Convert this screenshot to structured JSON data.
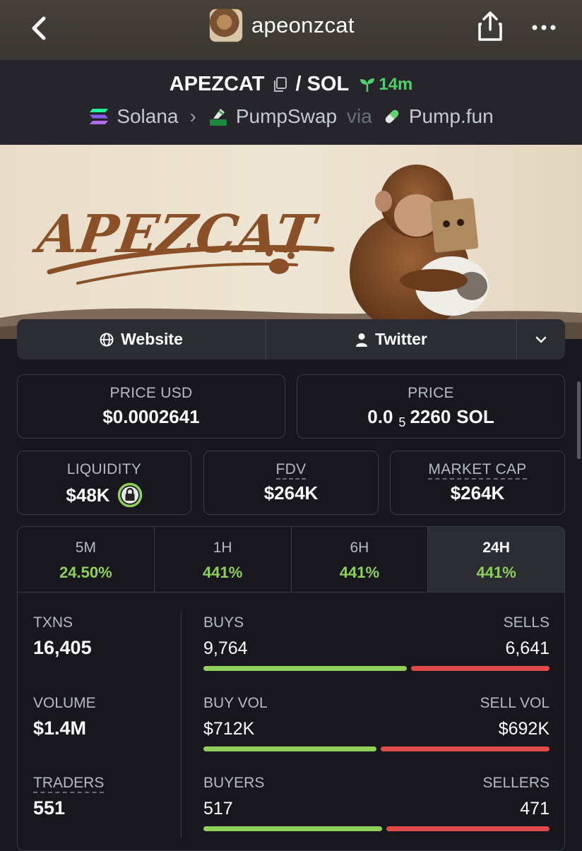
{
  "header": {
    "title": "apeonzcat"
  },
  "pair": {
    "base": "APEZCAT",
    "separator": "/",
    "quote": "SOL",
    "age": "14m",
    "chain": "Solana",
    "dex": "PumpSwap",
    "via": "via",
    "launchpad": "Pump.fun"
  },
  "banner": {
    "text": "APEZCAT"
  },
  "links": {
    "website": "Website",
    "twitter": "Twitter"
  },
  "price_usd": {
    "label": "PRICE USD",
    "value": "$0.0002641"
  },
  "price_native": {
    "label": "PRICE",
    "prefix": "0.0",
    "zeros": "5",
    "digits": "2260",
    "unit": "SOL"
  },
  "liquidity": {
    "label": "LIQUIDITY",
    "value": "$48K"
  },
  "fdv": {
    "label": "FDV",
    "value": "$264K"
  },
  "market_cap": {
    "label": "MARKET CAP",
    "value": "$264K"
  },
  "timeframes": [
    {
      "label": "5M",
      "change": "24.50%"
    },
    {
      "label": "1H",
      "change": "441%"
    },
    {
      "label": "6H",
      "change": "441%"
    },
    {
      "label": "24H",
      "change": "441%"
    }
  ],
  "stats": {
    "txns": {
      "label": "TXNS",
      "value": "16,405"
    },
    "volume": {
      "label": "VOLUME",
      "value": "$1.4M"
    },
    "traders": {
      "label": "TRADERS",
      "value": "551"
    },
    "buys": {
      "label": "BUYS",
      "value": "9,764",
      "share": 0.595
    },
    "sells": {
      "label": "SELLS",
      "value": "6,641"
    },
    "buy_vol": {
      "label": "BUY VOL",
      "value": "$712K",
      "share": 0.507
    },
    "sell_vol": {
      "label": "SELL VOL",
      "value": "$692K"
    },
    "buyers": {
      "label": "BUYERS",
      "value": "517",
      "share": 0.523
    },
    "sellers": {
      "label": "SELLERS",
      "value": "471"
    }
  },
  "colors": {
    "green": "#8ed05a",
    "red": "#e24a4a",
    "age_green": "#4fce6b",
    "bg": "#17171d"
  }
}
